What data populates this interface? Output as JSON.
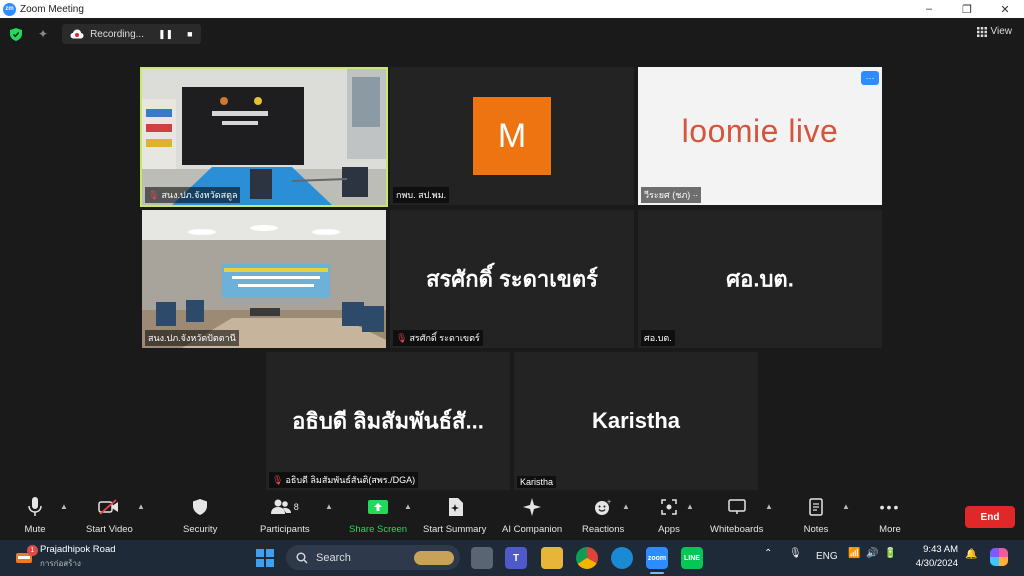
{
  "window": {
    "title": "Zoom Meeting",
    "min": "–",
    "max": "❐",
    "close": "✕"
  },
  "topbar": {
    "recording_label": "Recording...",
    "pause": "❚❚",
    "stop": "■",
    "view_label": "View"
  },
  "tiles": [
    {
      "name": "สนง.ปภ.จังหวัดสตูล",
      "muted": true,
      "type": "video",
      "active": true
    },
    {
      "name": "กพบ. สป.พม.",
      "muted": false,
      "type": "avatar",
      "avatar_letter": "M",
      "avatar_color": "#ee7411"
    },
    {
      "name": "วีระยศ (ชภ) ∙∙",
      "muted": false,
      "type": "logo",
      "logo_text_1": "loomie",
      "logo_text_2": "live",
      "logo_color": "#d4553c",
      "more": "···"
    },
    {
      "name": "สนง.ปภ.จังหวัดปัตตานี",
      "muted": false,
      "type": "video"
    },
    {
      "name": "สรศักดิ์ ระดาเขตร์",
      "display": "สรศักดิ์ ระดาเขตร์",
      "muted": true,
      "type": "name"
    },
    {
      "name": "ศอ.บต.",
      "display": "ศอ.บต.",
      "muted": false,
      "type": "name"
    },
    {
      "name": "อธิบดี ลิมสัมพันธ์สันติ(สพร./DGA)",
      "display": "อธิบดี ลิมสัมพันธ์สั...",
      "muted": true,
      "type": "name"
    },
    {
      "name": "Karistha",
      "display": "Karistha",
      "muted": false,
      "type": "name"
    }
  ],
  "toolbar": {
    "mute": "Mute",
    "start_video": "Start Video",
    "security": "Security",
    "participants": "Participants",
    "participants_count": "8",
    "share_screen": "Share Screen",
    "start_summary": "Start Summary",
    "ai_companion": "AI Companion",
    "reactions": "Reactions",
    "apps": "Apps",
    "whiteboards": "Whiteboards",
    "notes": "Notes",
    "more": "More",
    "end": "End"
  },
  "taskbar": {
    "weather_title": "Prajadhipok Road",
    "weather_sub": "การก่อสร้าง",
    "weather_badge": "1",
    "search_placeholder": "Search",
    "lang": "ENG",
    "time": "9:43 AM",
    "date": "4/30/2024"
  },
  "colors": {
    "accent_green": "#23d959",
    "end_red": "#e02828",
    "active_border": "#c9e86b",
    "mic_off": "#e0484a"
  }
}
